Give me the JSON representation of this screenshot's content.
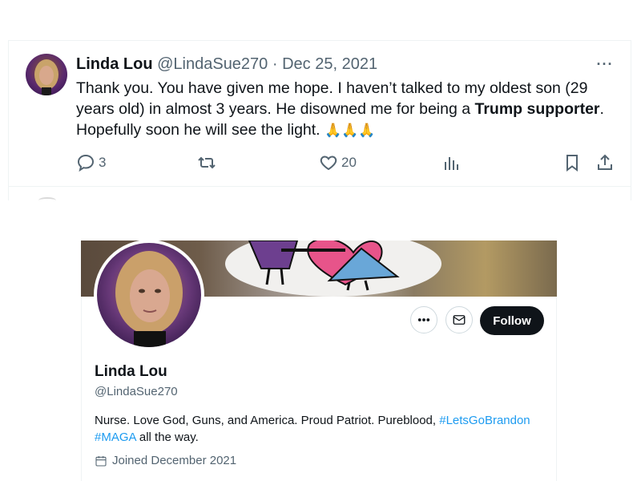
{
  "tweet": {
    "author_name": "Linda Lou",
    "author_handle": "@LindaSue270",
    "separator": "·",
    "date": "Dec 25, 2021",
    "more_label": "···",
    "text_part1": "Thank you. You have given me hope. I haven’t talked to my oldest son (29 years old) in almost 3 years. He disowned me for being a ",
    "text_bold": "Trump supporter",
    "text_part2": ". Hopefully soon he will see the light. ",
    "text_emoji": "🙏🙏🙏",
    "reply_count": "3",
    "retweet_count": "",
    "like_count": "20",
    "icons": [
      "reply-icon",
      "retweet-icon",
      "like-icon",
      "views-icon",
      "bookmark-icon",
      "share-icon"
    ]
  },
  "profile": {
    "name": "Linda Lou",
    "handle": "@LindaSue270",
    "more_label": "···",
    "follow_label": "Follow",
    "bio_text": "Nurse. Love God, Guns, and America. Proud Patriot. Pureblood, ",
    "bio_tag1": "#LetsGoBrandon",
    "bio_tag2": "#MAGA",
    "bio_tail": " all the way.",
    "joined": "Joined December 2021",
    "icons": [
      "more-icon",
      "message-icon",
      "calendar-icon"
    ]
  },
  "colors": {
    "text": "#0f1419",
    "muted": "#536471",
    "link": "#1d9bf0",
    "follow_bg": "#0f1419",
    "border": "#eff3f4"
  }
}
